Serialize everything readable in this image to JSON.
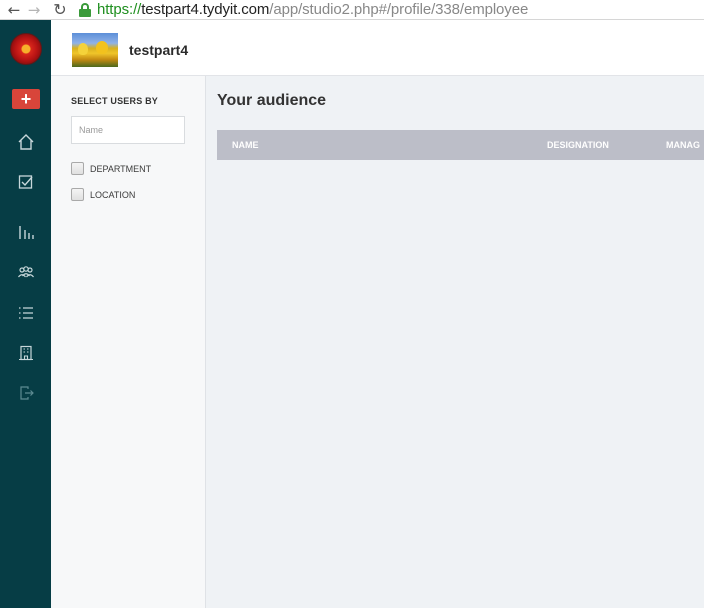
{
  "browser": {
    "url_scheme": "https://",
    "url_host": "testpart4.tydyit.com",
    "url_path": "/app/studio2.php#/profile/338/employee"
  },
  "rail": {
    "add_label": "+",
    "icons": [
      "home-icon",
      "tasks-icon",
      "chart-icon",
      "people-icon",
      "list-icon",
      "building-icon",
      "logout-icon"
    ]
  },
  "header": {
    "brand_name": "testpart4"
  },
  "filter": {
    "title": "SELECT USERS BY",
    "name_placeholder": "Name",
    "name_value": "",
    "options": [
      {
        "label": "DEPARTMENT",
        "checked": false
      },
      {
        "label": "LOCATION",
        "checked": false
      }
    ]
  },
  "main": {
    "title": "Your audience",
    "columns": [
      "NAME",
      "DESIGNATION",
      "MANAG"
    ]
  },
  "colors": {
    "rail": "#063d45",
    "add_button": "#d8453a",
    "table_header": "#bcbec8",
    "content_bg": "#eff2f5"
  }
}
